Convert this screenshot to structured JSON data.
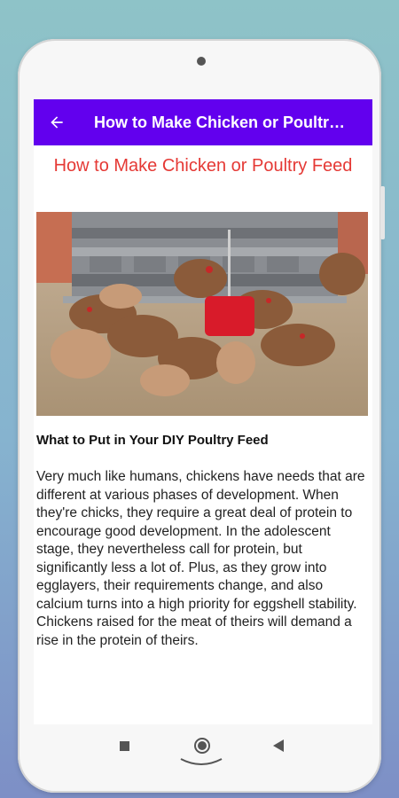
{
  "appbar": {
    "title": "How to Make Chicken or Poultry Feed",
    "back_icon": "arrow-left-icon",
    "background": "#6200ee"
  },
  "article": {
    "title": "How to Make Chicken or Poultry Feed",
    "title_color": "#e53935",
    "image_description": "chickens-feeding-around-red-feeder",
    "heading": "What to Put in Your DIY Poultry Feed",
    "paragraph": "Very much like humans, chickens have needs that are different at various phases of development. When they're chicks, they require a great deal of protein to encourage good development. In the adolescent stage, they nevertheless call for protein, but significantly less a lot of. Plus, as they grow into egglayers, their requirements change, and also calcium turns into a high priority for eggshell stability. Chickens raised for the meat of theirs will demand a rise in the protein of theirs."
  },
  "navbar": {
    "recent_icon": "square-icon",
    "home_icon": "circle-home-icon",
    "back_icon": "triangle-back-icon"
  }
}
